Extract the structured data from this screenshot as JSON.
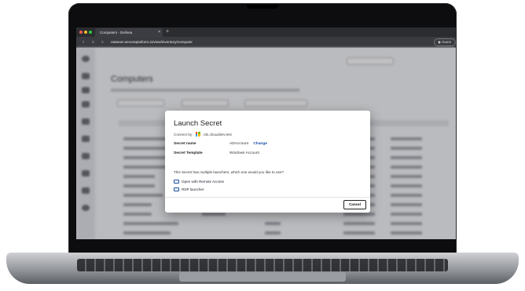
{
  "browser": {
    "tab_title": "Computers - Delinea",
    "tab_close": "×",
    "new_tab": "+",
    "url": "rasteam.secureplatform.io/view/inventory/computer",
    "back": "‹",
    "reload": "C",
    "profile": "Guest"
  },
  "page": {
    "title": "Computers"
  },
  "modal": {
    "title": "Launch Secret",
    "connect_by_label": "Connect by",
    "connect_by_value": "rds.cbuuddev.test",
    "fields": [
      {
        "label": "Secret name",
        "value": "ADAccount",
        "action": "Change"
      },
      {
        "label": "Secret Template",
        "value": "Windows Account"
      }
    ],
    "question": "This Secret has multiple launchers, which one would you like to use?",
    "launchers": [
      "Open with Remote Access",
      "RDP launcher"
    ],
    "cancel_label": "Cancel"
  },
  "colors": {
    "accent": "#1a4fa0",
    "ms_red": "#f25022",
    "ms_green": "#7fba00",
    "ms_blue": "#00a4ef",
    "ms_yellow": "#ffb900"
  }
}
